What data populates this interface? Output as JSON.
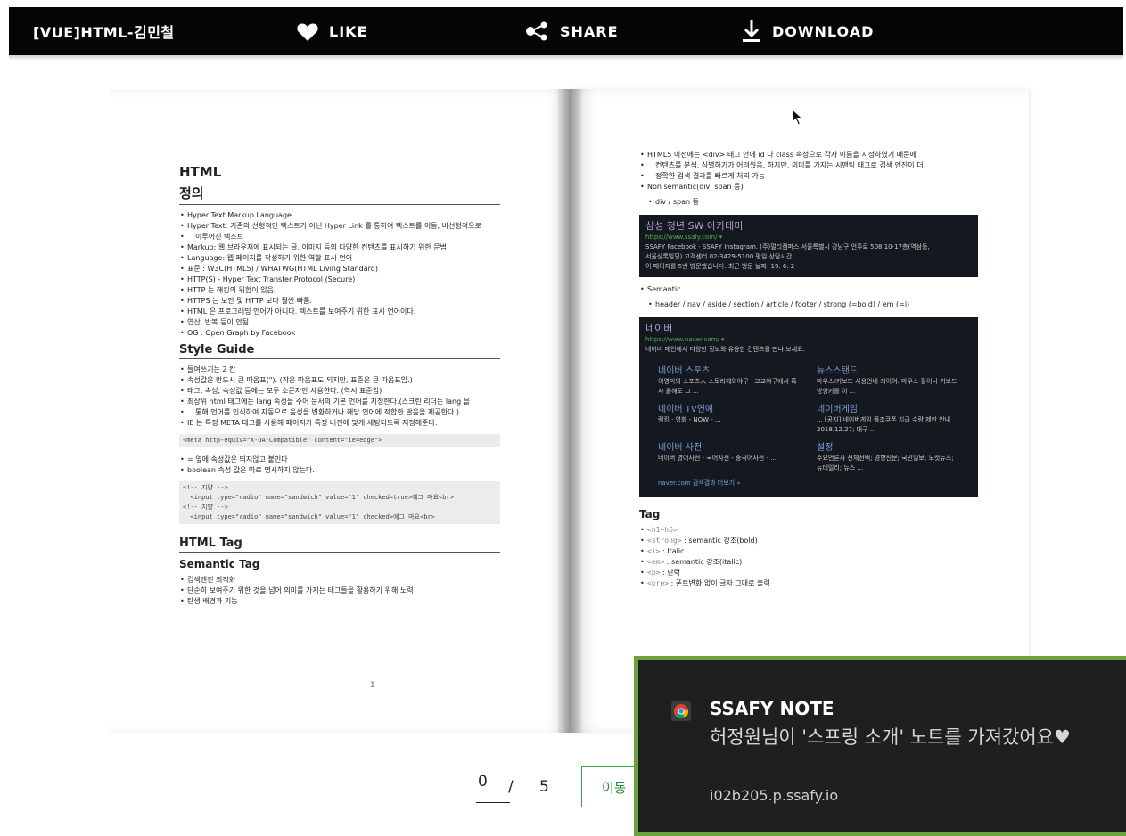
{
  "topbar": {
    "title": "[VUE]HTML-김민철",
    "like_label": "LIKE",
    "share_label": "SHARE",
    "download_label": "DOWNLOAD",
    "icons": [
      "heart-icon",
      "share-icon",
      "download-icon"
    ]
  },
  "left_page": {
    "h_html": "HTML",
    "h_def": "정의",
    "def_items": [
      "Hyper Text Markup Language",
      "Hyper Text: 기존의 선형적인 텍스트가 아닌 Hyper Link 를 통하여 텍스트를 이동, 비선형적으로",
      "이루어진 텍스트",
      "Markup: 웹 브라우저에 표시되는 글, 이미지 등의 다양한 컨텐츠를 표시하기 위한 문법",
      "Language: 웹 페이지를 작성하기 위한 역할 표시 언어",
      "표준 : W3C(HTML5) / WHATWG(HTML Living Standard)",
      "HTTP(S) - Hyper Text Transfer Protocol (Secure)",
      "HTTP 는 해킹의 위험이 있음.",
      "HTTPS 는 보안 및 HTTP 보다 훨씬 빠름.",
      "HTML 은 프로그래밍 언어가 아니다. 텍스트를 보여주기 위한 표시 언어이다.",
      "연산, 반복 등이 안됨.",
      "OG : Open Graph by Facebook"
    ],
    "h_style": "Style Guide",
    "style_items": [
      "들여쓰기는 2 칸",
      "속성값은 반드시 큰 따옴표(\"). (작은 따옴표도 되지만, 표준은 큰 따옴표임.)",
      "태그, 속성, 속성값 등에는 모두 소문자만 사용한다. (역시 표준임)",
      "최상위 html 태그에는 lang 속성을 주어 문서의 기본 언어를 지정한다.(스크린 리더는 lang 을",
      "통해 언어를 인식하여 자동으로 음성을 변환하거나 해당 언어에 적합한 발음을 제공한다.)",
      "IE 는 특정 META 태그를 사용해 페이지가 특정 버전에 맞게 세팅되도록 지정해준다."
    ],
    "code1": "<meta http-equiv=\"X-UA-Compatible\" content=\"ie=edge\">",
    "eq_items": [
      "= 옆에 속성값은 띄지않고 붙인다",
      "boolean 속성 값은 따로 명시하지 않는다."
    ],
    "code2": "<!-- 지양 -->\n  <input type=\"radio\" name=\"sandwich\" value=\"1\" checked=true>예그 마요<br>\n<!-- 지향 -->\n  <input type=\"radio\" name=\"sandwich\" value=\"1\" checked>예그 마요<br>",
    "h_tag": "HTML Tag",
    "h_semantic": "Semantic Tag",
    "semantic_items": [
      "검색엔진 최적화",
      "단순히 보여주기 위한 것을 넘어 의미를 가지는 태그들을 활용하기 위해 노력",
      "탄생 배경과 기능"
    ],
    "page_number": "1"
  },
  "right_page": {
    "intro_items": [
      "HTML5 이전에는 <div> 태그 안에 id 나 class 속성으로 각자 이름을 지정하였기 때문에",
      "컨텐츠를 분석, 식별하기가 어려웠음. 하지만, 의미를 가지는 시맨틱 태그로 검색 엔진이 더",
      "정확한 검색 결과를 빠르게 처리 가능",
      "Non semantic(div, span 등)"
    ],
    "intro_sub": "div / span 등",
    "ssafy": {
      "title": "삼성 청년 SW 아카데미",
      "url": "https://www.ssafy.com/ ▾",
      "line1": "SSAFY Facebook · SSAFY Instagram. (주)멀티캠퍼스 서울특별시 강남구 언주로 508 10-17층(역삼동,",
      "line2": "서울상록빌딩) 고객센터 02-3429-5100 평일 상담시간 ...",
      "line3": "이 페이지를 5번 방문했습니다. 최근 방문 날짜: 19. 6. 2"
    },
    "semantic_label": "Semantic",
    "semantic_sub": "header / nav / aside / section / article / footer / strong (=bold) / em (=i)",
    "naver": {
      "title": "네이버",
      "url": "https://www.naver.com/ ▾",
      "desc": "네이버 메인에서 다양한 정보와 유용한 컨텐츠를 만나 보세요.",
      "links": [
        {
          "title": "네이버 스포츠",
          "desc": "이영미의 스포츠人 스토리헤외야구 · 고교야구에서 혹사 올해도 그 ..."
        },
        {
          "title": "뉴스스탠드",
          "desc": "마우스/키보드 사용안내 레이어. 마우스 휠이나 키보드 방향키를 이 ..."
        },
        {
          "title": "네이버 TV연예",
          "desc": "랭킹 · 영화 - NOW - ..."
        },
        {
          "title": "네이버게임",
          "desc": "... [공지] 네이버게임 폴조쿠폰 지급 수량 제한 안내 2018.12.27; 대구 ..."
        },
        {
          "title": "네이버 사전",
          "desc": "네이버 영어사전 - 국어사전 - 중국어사전 - ..."
        },
        {
          "title": "설정",
          "desc": "주요언론사 전체선택; 경향신문; 국민일보; 노컷뉴스; 뉴데일리; 뉴스 ..."
        }
      ],
      "more": "naver.com 검색결과 더보기 »"
    },
    "tag_heading": "Tag",
    "tag_items": [
      {
        "code": "<h1~h6>",
        "text": ""
      },
      {
        "code": "<strong>",
        "text": " : semantic 강조(bold)"
      },
      {
        "code": "<i>",
        "text": " : Italic"
      },
      {
        "code": "<em>",
        "text": " : semantic 강조(italic)"
      },
      {
        "code": "<p>",
        "text": " : 단락"
      },
      {
        "code": "<pre>",
        "text": " : 폰트변화 없이 글자 그대로 출력"
      }
    ]
  },
  "pager": {
    "current": "0",
    "separator": "/",
    "total": "5",
    "go_label": "이동"
  },
  "notification": {
    "title": "SSAFY NOTE",
    "message": "허정원님이 '스프링 소개' 노트를 가져갔어요♥",
    "source": "i02b205.p.ssafy.io"
  },
  "colors": {
    "topbar": "#050505",
    "accent_green": "#3aa04a",
    "toast_border": "#6aa23c",
    "toast_bg": "#1f1f1f"
  }
}
